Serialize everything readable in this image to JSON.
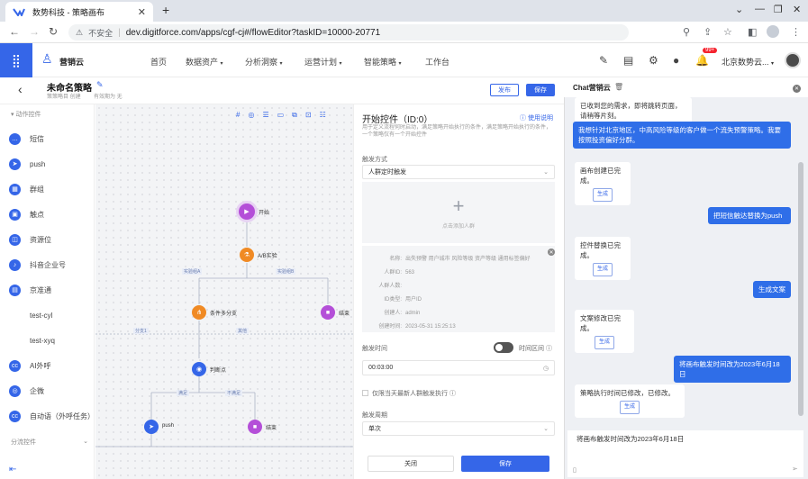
{
  "browser": {
    "tab_title": "数势科技 - 策略画布",
    "url": "dev.digitforce.com/apps/cgf-cj#/flowEditor?taskID=10000-20771",
    "security_label": "不安全"
  },
  "header": {
    "brand": "营销云",
    "nav": [
      "首页",
      "数据资产",
      "分析洞察",
      "运营计划",
      "智能策略",
      "工作台"
    ],
    "notification_count": "99+",
    "org": "北京数势云..."
  },
  "page": {
    "title": "未命名策略",
    "tag1": "策策略目 创建",
    "tag2": "有效期为 无",
    "publish_label": "发布",
    "save_label": "保存"
  },
  "palette": {
    "category1": "动作控件",
    "items": [
      {
        "label": "短信",
        "color": "#3566e8",
        "icon": "sms-icon",
        "glyph": "…"
      },
      {
        "label": "push",
        "color": "#3566e8",
        "icon": "push-icon",
        "glyph": "➤"
      },
      {
        "label": "群组",
        "color": "#3566e8",
        "icon": "group-icon",
        "glyph": "▦"
      },
      {
        "label": "触点",
        "color": "#3566e8",
        "icon": "touchpoint-icon",
        "glyph": "▣"
      },
      {
        "label": "资源位",
        "color": "#3566e8",
        "icon": "resource-icon",
        "glyph": "◫"
      },
      {
        "label": "抖音企业号",
        "color": "#3566e8",
        "icon": "douyin-icon",
        "glyph": "♪"
      },
      {
        "label": "京准通",
        "color": "#3566e8",
        "icon": "jzt-icon",
        "glyph": "▤"
      },
      {
        "label": "test-cyl",
        "color": "#ffffff",
        "icon": "blank-icon",
        "glyph": ""
      },
      {
        "label": "test-xyq",
        "color": "#ffffff",
        "icon": "blank-icon",
        "glyph": ""
      },
      {
        "label": "AI外呼",
        "color": "#3566e8",
        "icon": "ai-call-icon",
        "glyph": "cc"
      },
      {
        "label": "企微",
        "color": "#3566e8",
        "icon": "wecom-icon",
        "glyph": "◎"
      },
      {
        "label": "自动语（外呼任务）",
        "color": "#3566e8",
        "icon": "auto-call-icon",
        "glyph": "cc"
      }
    ],
    "category2": "分流控件"
  },
  "canvas": {
    "nodes": [
      {
        "id": "start",
        "label": "开始",
        "color": "#b44fd8",
        "glyph": "▶"
      },
      {
        "id": "ab",
        "label": "A/B实验",
        "color": "#f08a24",
        "glyph": "⚗"
      },
      {
        "id": "multi",
        "label": "条件多分支",
        "color": "#f08a24",
        "glyph": "⋔"
      },
      {
        "id": "end1",
        "label": "结束",
        "color": "#b44fd8",
        "glyph": "■"
      },
      {
        "id": "judge",
        "label": "判断点",
        "color": "#3566e8",
        "glyph": "◉"
      },
      {
        "id": "push",
        "label": "push",
        "color": "#3566e8",
        "glyph": "➤"
      },
      {
        "id": "end2",
        "label": "结束",
        "color": "#b44fd8",
        "glyph": "■"
      }
    ],
    "edge_tags": [
      "实验组A",
      "实验组B",
      "分支1",
      "其他",
      "满足",
      "不满足"
    ]
  },
  "props": {
    "title": "开始控件（ID:0）",
    "usage": "使用说明",
    "desc": "用于定义流程何时启动，满足策略开始执行的条件，满足策略开始执行的条件，一个策略仅有一个开始控件",
    "trigger_label": "触发方式",
    "trigger_value": "人群定时触发",
    "add_crowd": "点击添加人群",
    "crowd_info": [
      {
        "k": "名称:",
        "v": "出失预警 用户城市 风险等级 资产等级 通用标签偏好"
      },
      {
        "k": "人群ID:",
        "v": "563"
      },
      {
        "k": "人群人数:",
        "v": ""
      },
      {
        "k": "ID类型:",
        "v": "用户ID"
      },
      {
        "k": "创建人:",
        "v": "admin"
      },
      {
        "k": "创建时间:",
        "v": "2023-05-31 15:25:13"
      }
    ],
    "trigger_time_label": "触发时间",
    "time_range": "时间区间",
    "time_value": "00:03:00",
    "checkbox_label": "仅限当天最新人群触发执行",
    "cycle_label": "触发周期",
    "cycle_value": "单次",
    "close_label": "关闭",
    "save_label": "保存"
  },
  "chat": {
    "title": "Chat营销云",
    "messages": [
      {
        "role": "bot",
        "text": "已收到您的需求，即将跳转页面，请稍等片刻。"
      },
      {
        "role": "user",
        "text": "我想针对北京地区，中高风险等级的客户做一个流失预警策略。我要按照投资偏好分群。"
      },
      {
        "role": "bot",
        "text": "画布创建已完成。",
        "button": "生成"
      },
      {
        "role": "user",
        "text": "把短信触达替换为push"
      },
      {
        "role": "bot",
        "text": "控件替换已完成。",
        "button": "生成"
      },
      {
        "role": "user",
        "text": "生成文案"
      },
      {
        "role": "bot",
        "text": "文案修改已完成。",
        "button": "生成"
      },
      {
        "role": "user",
        "text": "将画布触发时间改为2023年6月18日"
      },
      {
        "role": "bot",
        "text": "策略执行时间已修改，已修改。",
        "button": "生成"
      }
    ],
    "input_value": "将画布触发时间改为2023年6月18日"
  }
}
